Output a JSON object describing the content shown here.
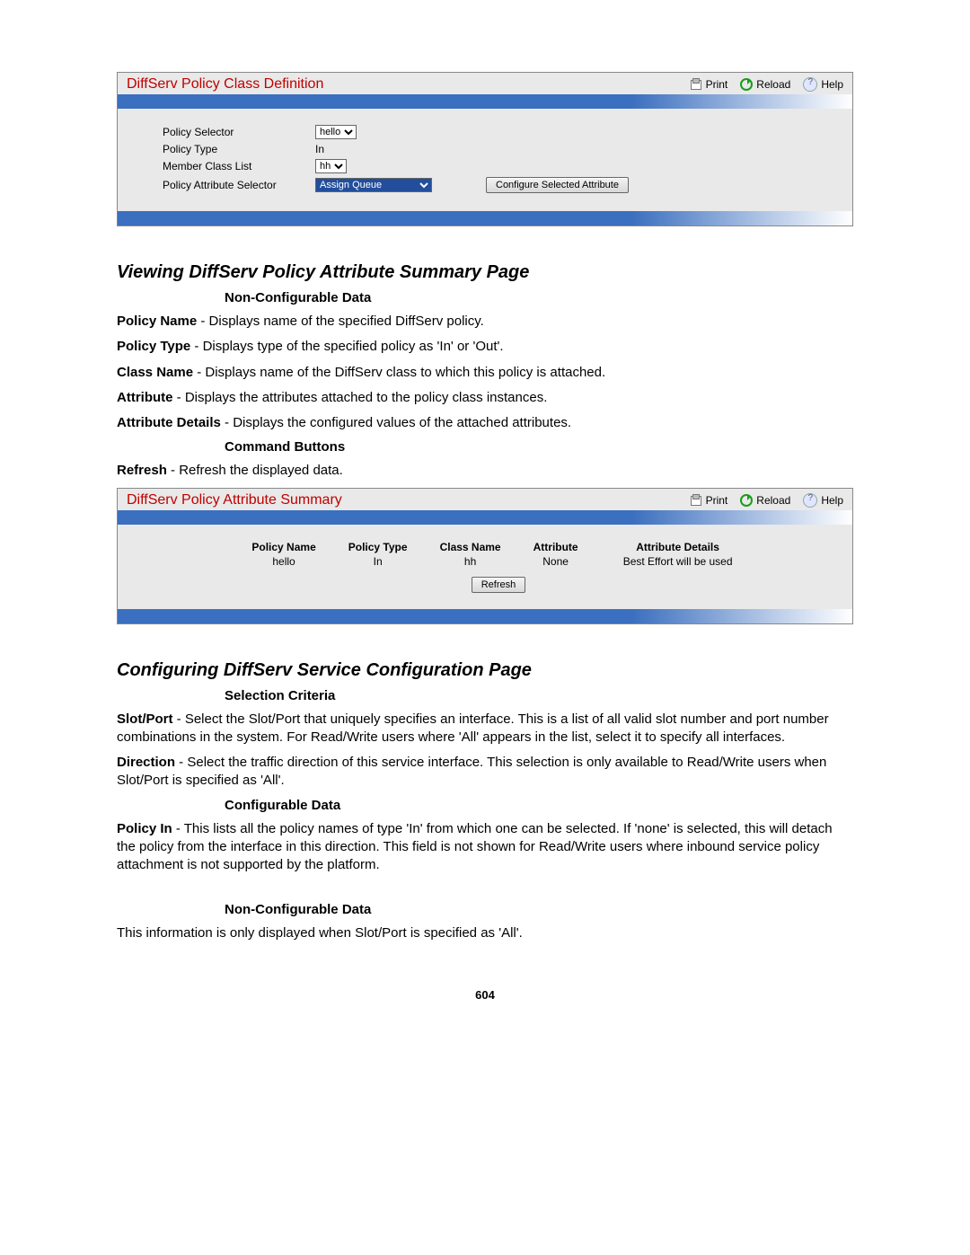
{
  "hdr_links": {
    "print": "Print",
    "reload": "Reload",
    "help": "Help"
  },
  "panel1": {
    "title": "DiffServ Policy Class Definition",
    "rows": {
      "policy_selector": {
        "label": "Policy Selector",
        "value": "hello"
      },
      "policy_type": {
        "label": "Policy Type",
        "value": "In"
      },
      "member_class": {
        "label": "Member Class List",
        "value": "hh"
      },
      "attr_selector": {
        "label": "Policy Attribute Selector",
        "value": "Assign Queue"
      }
    },
    "configure_btn": "Configure Selected Attribute"
  },
  "section1_heading": "Viewing DiffServ Policy Attribute Summary Page",
  "ncd_heading": "Non-Configurable Data",
  "s1_items": {
    "policy_name": {
      "k": "Policy Name",
      "v": " - Displays name of the specified DiffServ policy."
    },
    "policy_type": {
      "k": "Policy Type",
      "v": " - Displays type of the specified policy as 'In' or 'Out'."
    },
    "class_name": {
      "k": "Class Name",
      "v": " - Displays name of the DiffServ class to which this policy is attached."
    },
    "attribute": {
      "k": "Attribute",
      "v": " - Displays the attributes attached to the policy class instances."
    },
    "attribute_det": {
      "k": "Attribute Details",
      "v": " - Displays the configured values of the attached attributes."
    }
  },
  "cmd_heading": "Command Buttons",
  "refresh_item": {
    "k": "Refresh",
    "v": " - Refresh the displayed data."
  },
  "panel2": {
    "title": "DiffServ Policy Attribute Summary",
    "cols": [
      "Policy Name",
      "Policy Type",
      "Class Name",
      "Attribute",
      "Attribute Details"
    ],
    "row": [
      "hello",
      "In",
      "hh",
      "None",
      "Best Effort will be used"
    ],
    "refresh_btn": "Refresh"
  },
  "section2_heading": "Configuring DiffServ Service Configuration Page",
  "sel_heading": "Selection Criteria",
  "s2_slot": {
    "k": "Slot/Port",
    "v": " - Select the Slot/Port that uniquely specifies an interface. This is a list of all valid slot number and port number combinations in the system. For Read/Write users where 'All' appears in the list, select it to specify all interfaces."
  },
  "s2_dir": {
    "k": "Direction",
    "v": " - Select the traffic direction of this service interface. This selection is only available to Read/Write users when Slot/Port is specified as 'All'."
  },
  "cfg_heading": "Configurable Data",
  "s2_polin": {
    "k": "Policy In",
    "v": " - This lists all the policy names of type 'In' from which one can be selected. If 'none' is selected, this will detach the policy from the interface in this direction. This field is not shown for Read/Write users where inbound service policy attachment is not supported by the platform."
  },
  "ncd2_heading": "Non-Configurable Data",
  "ncd2_text": "This information is only displayed when Slot/Port is specified as 'All'.",
  "page_number": "604"
}
